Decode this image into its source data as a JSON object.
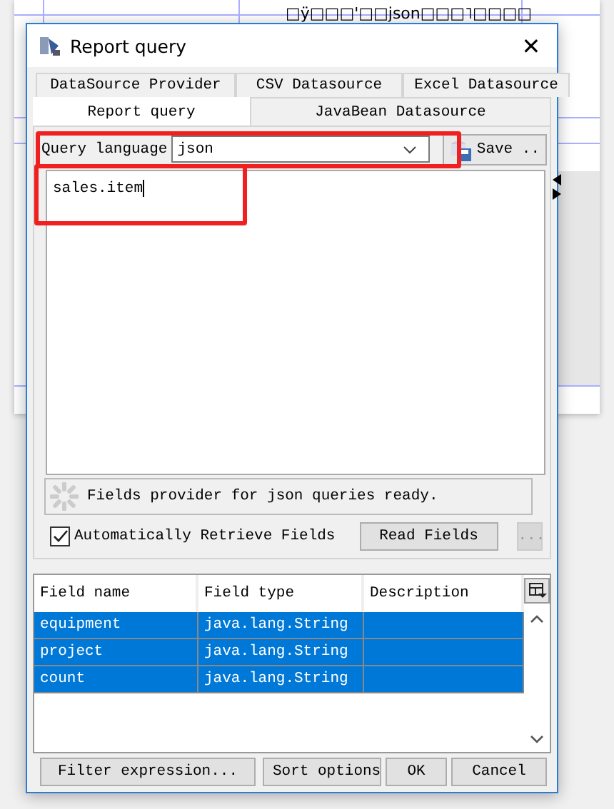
{
  "background_window": {
    "header_text": "□ÿ□□□'□□json□□□˥□□□□"
  },
  "dialog": {
    "title": "Report query",
    "close": "✕"
  },
  "tab_rows": [
    [
      {
        "label": "DataSource Provider",
        "selected": false
      },
      {
        "label": "CSV Datasource",
        "selected": false
      },
      {
        "label": "Excel Datasource",
        "selected": false
      }
    ],
    [
      {
        "label": "Report query",
        "selected": true
      },
      {
        "label": "JavaBean Datasource",
        "selected": false
      }
    ]
  ],
  "query_language": {
    "label": "Query language",
    "value": "json",
    "save_button": "Save .."
  },
  "query_text": "sales.item",
  "status": "Fields provider for json queries ready.",
  "auto_retrieve": {
    "label": "Automatically Retrieve Fields",
    "checked": true
  },
  "read_fields_button": "Read Fields",
  "more_button": "...",
  "table": {
    "columns": [
      "Field name",
      "Field type",
      "Description"
    ],
    "rows": [
      {
        "cells": [
          "equipment",
          "java.lang.String",
          ""
        ],
        "selected": true
      },
      {
        "cells": [
          "project",
          "java.lang.String",
          ""
        ],
        "selected": true
      },
      {
        "cells": [
          "count",
          "java.lang.String",
          ""
        ],
        "selected": true
      }
    ]
  },
  "buttons": [
    "Filter expression...",
    "Sort options",
    "OK",
    "Cancel"
  ]
}
